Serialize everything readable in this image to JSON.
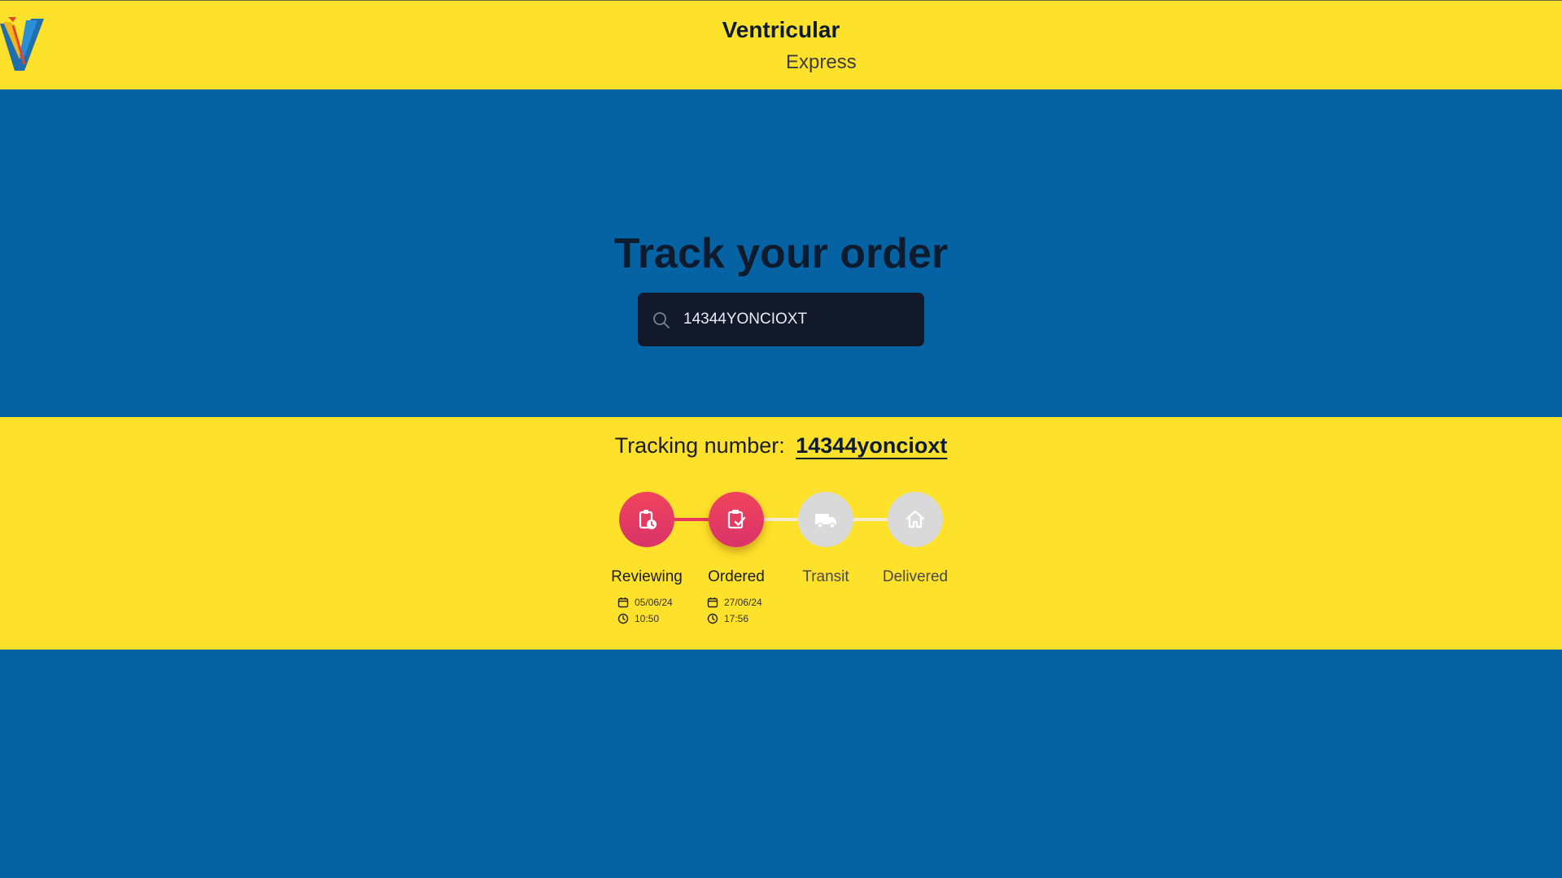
{
  "brand": {
    "name": "Ventricular",
    "subtitle": "Express"
  },
  "hero": {
    "title": "Track your order",
    "search": {
      "value": "14344YONCIOXT",
      "placeholder": ""
    }
  },
  "tracking": {
    "label": "Tracking number:",
    "number": "14344yoncioxt",
    "steps": [
      {
        "label": "Reviewing",
        "icon": "clipboard-clock-icon",
        "state": "active",
        "date": "05/06/24",
        "time": "10:50"
      },
      {
        "label": "Ordered",
        "icon": "clipboard-check-icon",
        "state": "active",
        "date": "27/06/24",
        "time": "17:56"
      },
      {
        "label": "Transit",
        "icon": "truck-icon",
        "state": "inactive"
      },
      {
        "label": "Delivered",
        "icon": "home-icon",
        "state": "inactive"
      }
    ]
  },
  "colors": {
    "yellow": "#fde12b",
    "blue": "#0563a3",
    "active_step": "#e8385e",
    "inactive_step": "#d9d9d9",
    "search_bg": "#12192b"
  }
}
